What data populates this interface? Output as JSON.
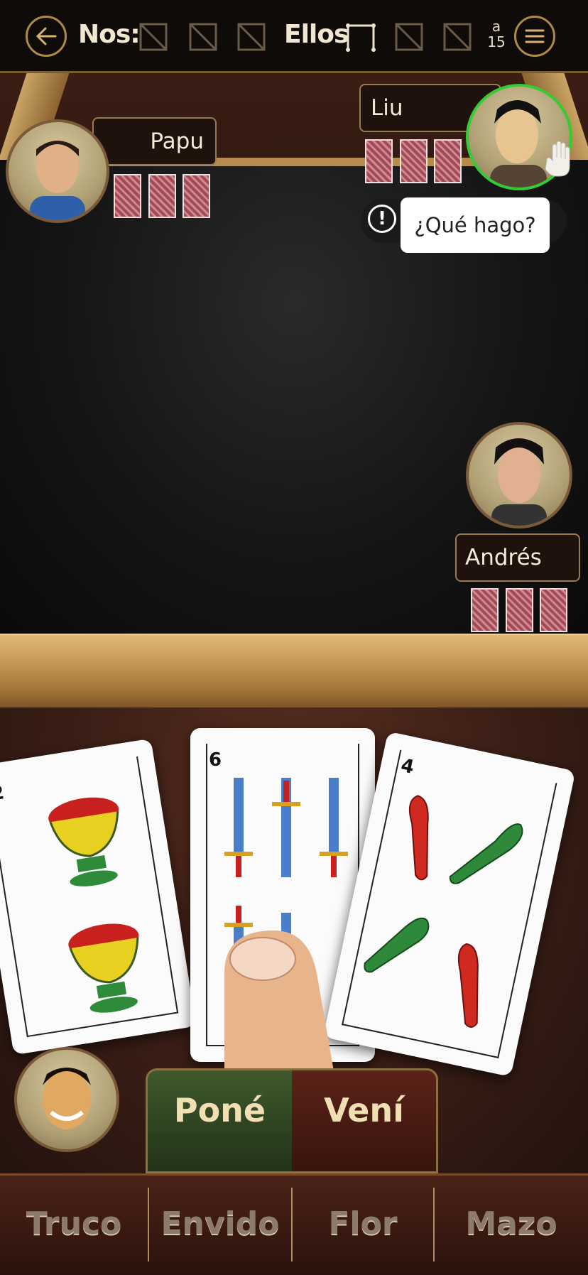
{
  "header": {
    "back_label": "back",
    "us_label": "Nos:",
    "them_label": "Ellos",
    "target_prefix": "a",
    "target_points": "15"
  },
  "players": {
    "left": {
      "name": "Papu"
    },
    "top_right": {
      "name": "Liu",
      "status": "¿Qué hago?"
    },
    "right": {
      "name": "Andrés"
    }
  },
  "hand": {
    "cards": [
      {
        "rank": "2",
        "suit": "copas"
      },
      {
        "rank": "6",
        "suit": "espadas"
      },
      {
        "rank": "4",
        "suit": "bastos"
      }
    ]
  },
  "actions": {
    "pone": "Poné",
    "veni": "Vení"
  },
  "bottom_menu": {
    "truco": "Truco",
    "envido": "Envido",
    "flor": "Flor",
    "mazo": "Mazo"
  },
  "icons": [
    "back-arrow-icon",
    "menu-icon",
    "hand-raise-icon",
    "alert-icon"
  ],
  "colors": {
    "accent": "#b08848",
    "active_player": "#33cc33",
    "pone_bg": "#3f5a2c",
    "veni_bg": "#5a2218"
  }
}
